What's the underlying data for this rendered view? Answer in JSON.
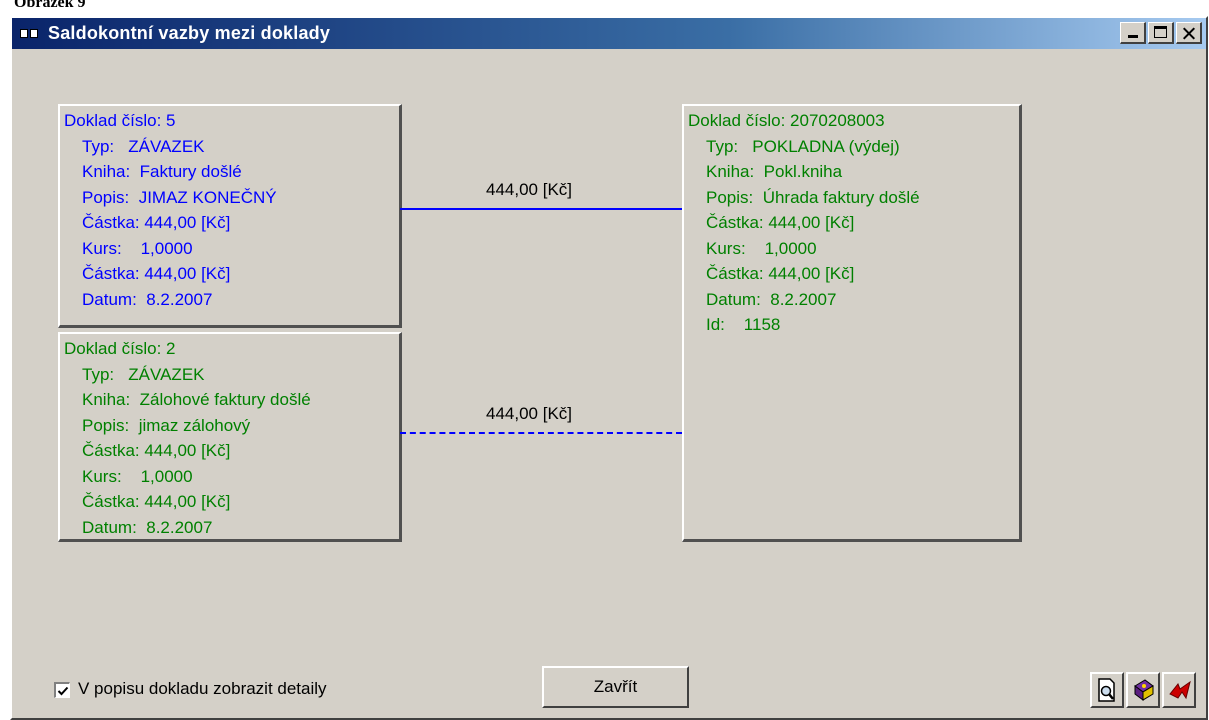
{
  "caption": "Obrázek 9",
  "window": {
    "title": "Saldokontní vazby mezi doklady"
  },
  "documents": {
    "doc1": {
      "color": "#0000ff",
      "number": "Doklad číslo: 5",
      "typ": "Typ:   ZÁVAZEK",
      "kniha": "Kniha:  Faktury došlé",
      "popis": "Popis:  JIMAZ KONEČNÝ",
      "castka1": "Částka: 444,00 [Kč]",
      "kurs": "Kurs:    1,0000",
      "castka2": "Částka: 444,00 [Kč]",
      "datum": "Datum:  8.2.2007"
    },
    "doc2": {
      "color": "#008000",
      "number": "Doklad číslo: 2",
      "typ": "Typ:   ZÁVAZEK",
      "kniha": "Kniha:  Zálohové faktury došlé",
      "popis": "Popis:  jimaz zálohový",
      "castka1": "Částka: 444,00 [Kč]",
      "kurs": "Kurs:    1,0000",
      "castka2": "Částka: 444,00 [Kč]",
      "datum": "Datum:  8.2.2007"
    },
    "doc3": {
      "color": "#008000",
      "number": "Doklad číslo: 2070208003",
      "typ": "Typ:   POKLADNA (výdej)",
      "kniha": "Kniha:  Pokl.kniha",
      "popis": "Popis:  Úhrada faktury došlé",
      "castka1": "Částka: 444,00 [Kč]",
      "kurs": "Kurs:    1,0000",
      "castka2": "Částka: 444,00 [Kč]",
      "datum": "Datum:  8.2.2007",
      "id": "Id:    1158"
    }
  },
  "links": {
    "link1": "444,00 [Kč]",
    "link2": "444,00 [Kč]"
  },
  "footer": {
    "checkbox_label": "V popisu dokladu zobrazit detaily",
    "checkbox_checked": true,
    "close_label": "Zavřít"
  },
  "icons": {
    "preview": "print-preview-icon",
    "book": "help-book-icon",
    "exit": "exit-icon"
  }
}
